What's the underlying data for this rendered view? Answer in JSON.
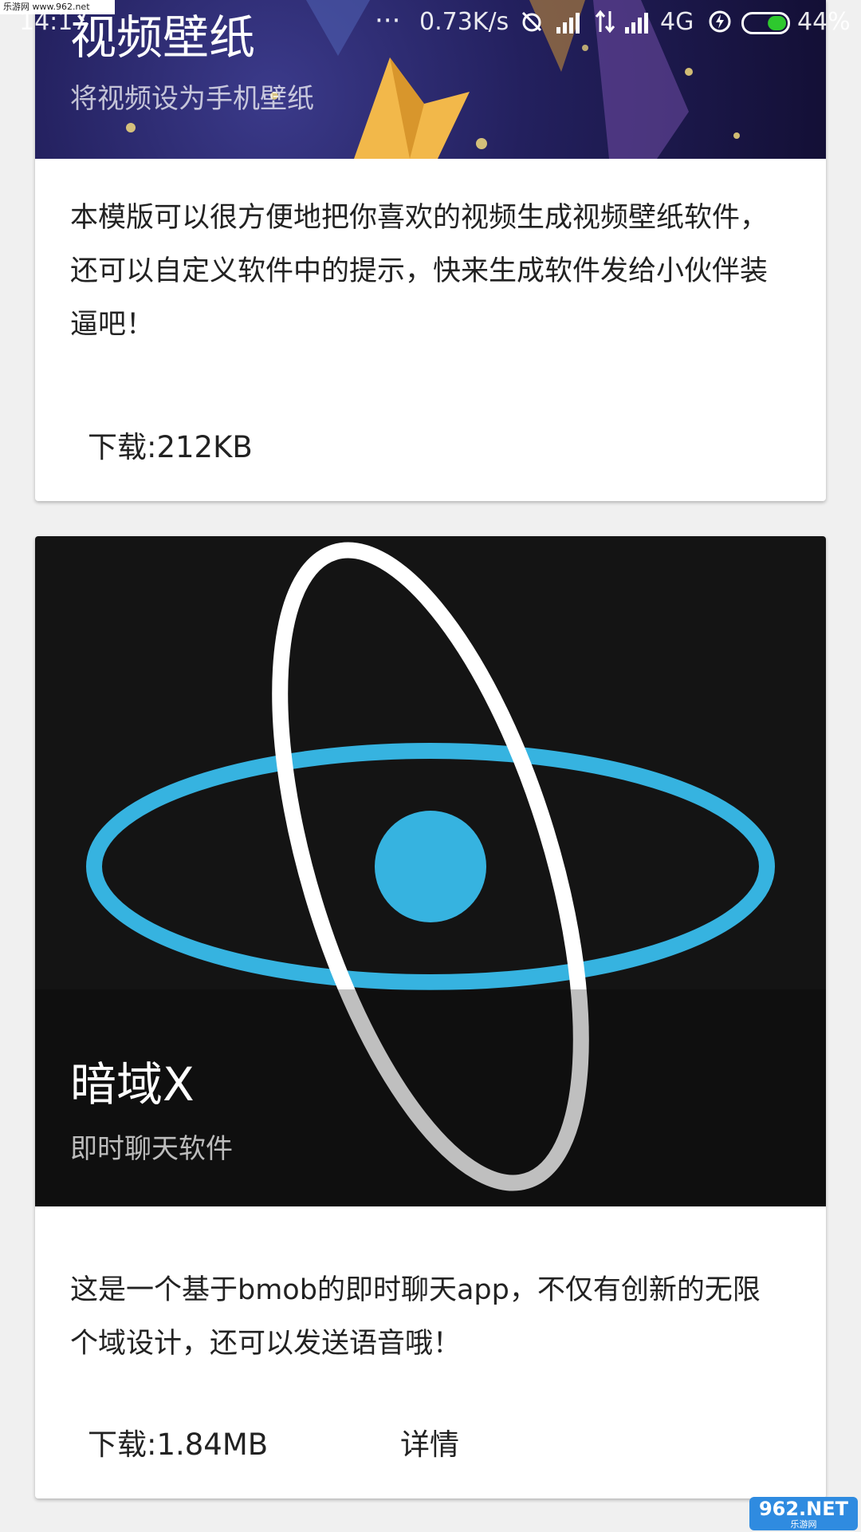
{
  "watermark": {
    "text": "乐游网 www.962.net"
  },
  "status_bar": {
    "time": "14:17",
    "speed": "0.73K/s",
    "network": "4G",
    "battery": "44%",
    "battery_level": 0.44
  },
  "cards": [
    {
      "title": "视频壁纸",
      "subtitle": "将视频设为手机壁纸",
      "description": "本模版可以很方便地把你喜欢的视频生成视频壁纸软件，还可以自定义软件中的提示，快来生成软件发给小伙伴装逼吧！",
      "download_label": "下载:212KB"
    },
    {
      "title": "暗域X",
      "subtitle": "即时聊天软件",
      "description": "这是一个基于bmob的即时聊天app，不仅有创新的无限个域设计，还可以发送语音哦！",
      "download_label": "下载:1.84MB",
      "details_label": "详情"
    }
  ],
  "footer_logo": {
    "brand": "962.NET",
    "sub": "乐游网"
  },
  "colors": {
    "accent_blue": "#36b3e0",
    "battery_green": "#2ec82e"
  }
}
